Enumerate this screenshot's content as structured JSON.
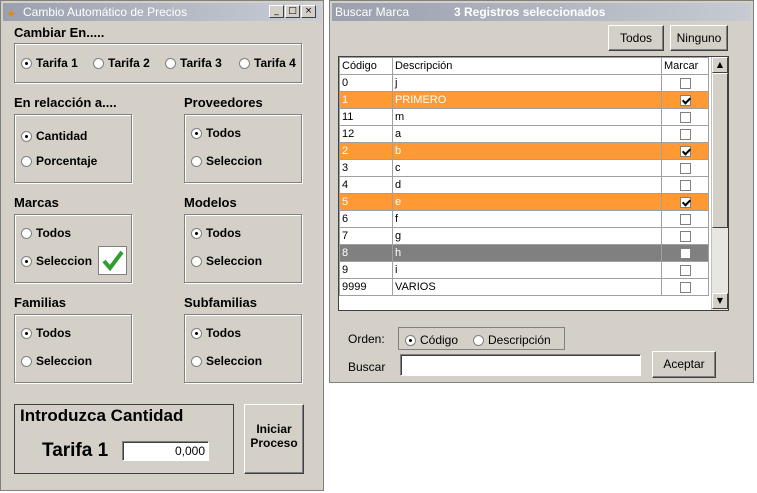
{
  "left": {
    "title": "Cambio Automático de Precios",
    "cambiar_label": "Cambiar En.....",
    "tarifas": [
      {
        "label": "Tarifa 1",
        "checked": true
      },
      {
        "label": "Tarifa 2",
        "checked": false
      },
      {
        "label": "Tarifa 3",
        "checked": false
      },
      {
        "label": "Tarifa 4",
        "checked": false
      }
    ],
    "relacion": {
      "label": "En relacción a....",
      "options": [
        "Cantidad",
        "Porcentaje"
      ],
      "selected": 0
    },
    "proveedores": {
      "label": "Proveedores",
      "options": [
        "Todos",
        "Seleccion"
      ],
      "selected": 0
    },
    "marcas": {
      "label": "Marcas",
      "options": [
        "Todos",
        "Seleccion"
      ],
      "selected": 1
    },
    "modelos": {
      "label": "Modelos",
      "options": [
        "Todos",
        "Seleccion"
      ],
      "selected": 0
    },
    "familias": {
      "label": "Familias",
      "options": [
        "Todos",
        "Seleccion"
      ],
      "selected": 0
    },
    "subfamilias": {
      "label": "Subfamilias",
      "options": [
        "Todos",
        "Seleccion"
      ],
      "selected": 0
    },
    "introduzca": "Introduzca Cantidad",
    "tarifa_label": "Tarifa 1",
    "cantidad_value": "0,000",
    "iniciar_line1": "Iniciar",
    "iniciar_line2": "Proceso"
  },
  "right": {
    "title": "Buscar Marca",
    "selected_count": "3 Registros seleccionados",
    "todos_btn": "Todos",
    "ninguno_btn": "Ninguno",
    "columns": [
      "Código",
      "Descripción",
      "Marcar"
    ],
    "rows": [
      {
        "codigo": "0",
        "descripcion": "j",
        "marcado": false,
        "style": "white"
      },
      {
        "codigo": "1",
        "descripcion": "PRIMERO",
        "marcado": true,
        "style": "orange"
      },
      {
        "codigo": "11",
        "descripcion": "m",
        "marcado": false,
        "style": "white"
      },
      {
        "codigo": "12",
        "descripcion": "a",
        "marcado": false,
        "style": "white"
      },
      {
        "codigo": "2",
        "descripcion": "b",
        "marcado": true,
        "style": "orange"
      },
      {
        "codigo": "3",
        "descripcion": "c",
        "marcado": false,
        "style": "white"
      },
      {
        "codigo": "4",
        "descripcion": "d",
        "marcado": false,
        "style": "white"
      },
      {
        "codigo": "5",
        "descripcion": "e",
        "marcado": true,
        "style": "orange"
      },
      {
        "codigo": "6",
        "descripcion": "f",
        "marcado": false,
        "style": "white"
      },
      {
        "codigo": "7",
        "descripcion": "g",
        "marcado": false,
        "style": "white"
      },
      {
        "codigo": "8",
        "descripcion": "h",
        "marcado": false,
        "style": "gray"
      },
      {
        "codigo": "9",
        "descripcion": "i",
        "marcado": false,
        "style": "white"
      },
      {
        "codigo": "9999",
        "descripcion": "VARIOS",
        "marcado": false,
        "style": "white"
      }
    ],
    "orden_label": "Orden:",
    "orden_options": [
      {
        "label": "Código",
        "checked": true
      },
      {
        "label": "Descripción",
        "checked": false
      }
    ],
    "buscar_label": "Buscar",
    "buscar_value": "",
    "aceptar_btn": "Aceptar"
  },
  "colors": {
    "highlight": "#ff9933",
    "selected_row": "#808080",
    "window_bg": "#d4d0c8",
    "check_green": "#2e9e2e"
  }
}
